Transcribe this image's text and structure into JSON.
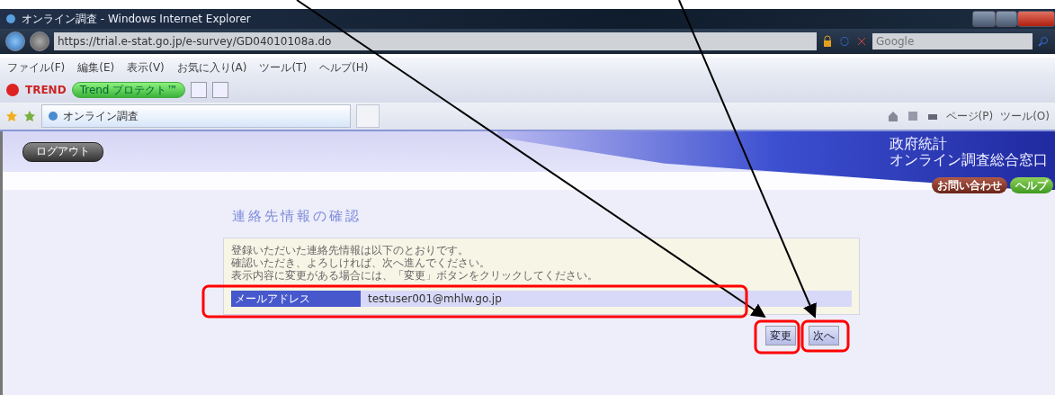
{
  "window": {
    "title": "オンライン調査 - Windows Internet Explorer"
  },
  "address_bar": {
    "url": "https://trial.e-stat.go.jp/e-survey/GD04010108a.do"
  },
  "search_box": {
    "placeholder": "Google"
  },
  "menu": [
    "ファイル(F)",
    "編集(E)",
    "表示(V)",
    "お気に入り(A)",
    "ツール(T)",
    "ヘルプ(H)"
  ],
  "toolbar": {
    "brand": "TREND",
    "protect_button": "Trend プロテクト™"
  },
  "tabs": [
    {
      "label": "オンライン調査",
      "selected": true
    }
  ],
  "command_bar": [
    "ページ(P)",
    "ツール(O)"
  ],
  "page": {
    "logout": "ログアウト",
    "site_title": [
      "政府統計",
      "オンライン調査総合窓口"
    ],
    "contact_button": "お問い合わせ",
    "help_button": "ヘルプ",
    "heading": "連絡先情報の確認",
    "intro": [
      "登録いただいた連絡先情報は以下のとおりです。",
      "確認いただき、よろしければ、次へ進んでください。",
      "表示内容に変更がある場合には、「変更」ボタンをクリックしてください。"
    ],
    "fields": [
      {
        "label": "メールアドレス",
        "value": "testuser001@mhlw.go.jp"
      }
    ],
    "buttons": [
      "変更",
      "次へ"
    ]
  }
}
